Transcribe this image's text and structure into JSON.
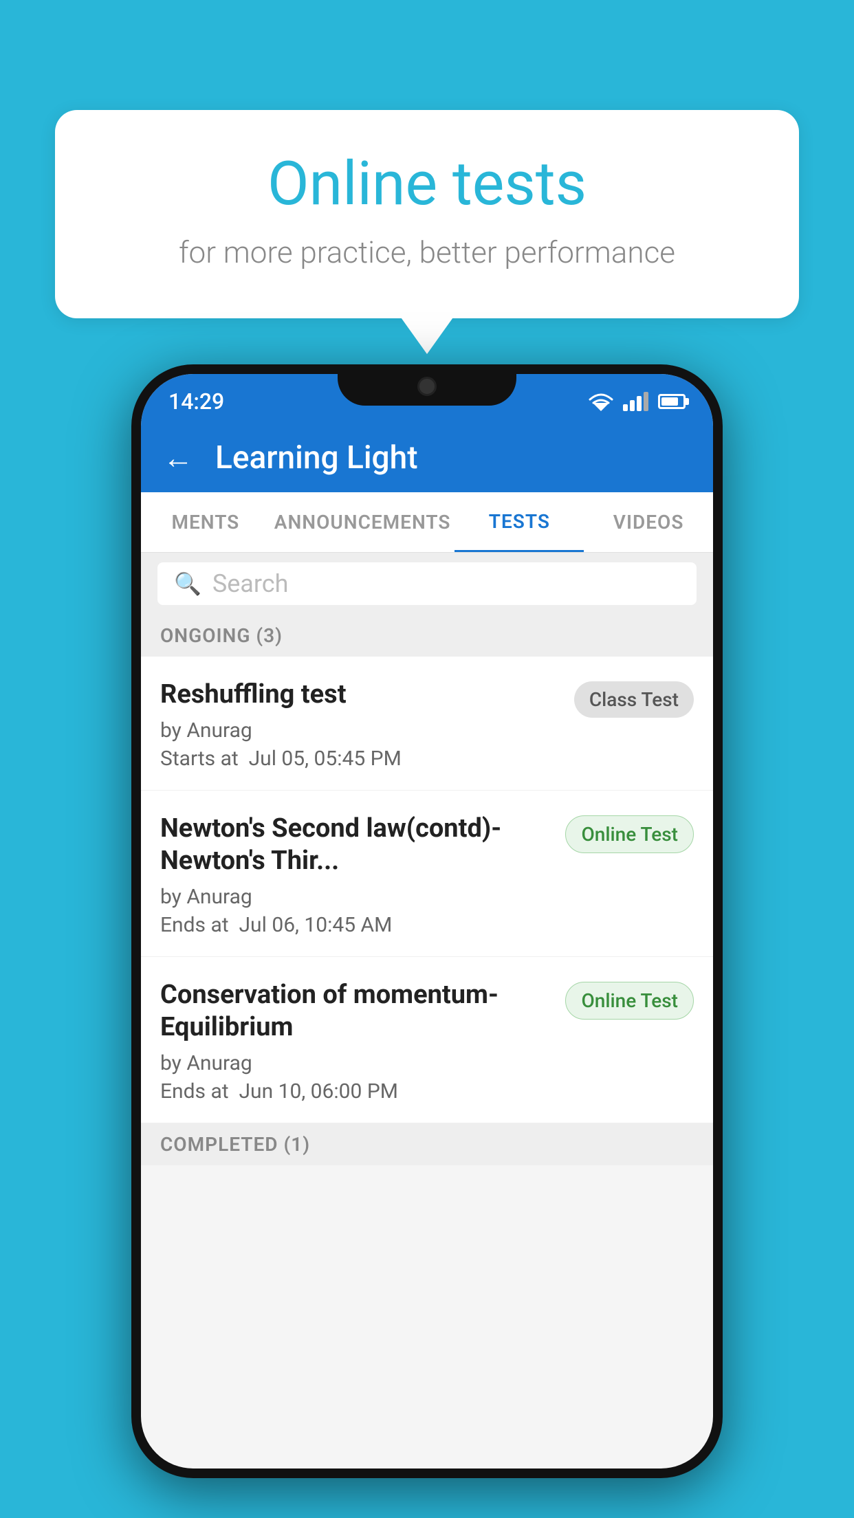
{
  "background_color": "#29b6d8",
  "speech_bubble": {
    "title": "Online tests",
    "subtitle": "for more practice, better performance"
  },
  "phone": {
    "status_bar": {
      "time": "14:29"
    },
    "header": {
      "title": "Learning Light",
      "back_label": "←"
    },
    "tabs": [
      {
        "label": "MENTS",
        "active": false
      },
      {
        "label": "ANNOUNCEMENTS",
        "active": false
      },
      {
        "label": "TESTS",
        "active": true
      },
      {
        "label": "VIDEOS",
        "active": false
      }
    ],
    "search": {
      "placeholder": "Search"
    },
    "ongoing_section": {
      "label": "ONGOING (3)"
    },
    "test_items": [
      {
        "name": "Reshuffling test",
        "by": "by Anurag",
        "time_label": "Starts at",
        "time": "Jul 05, 05:45 PM",
        "badge": "Class Test",
        "badge_type": "class"
      },
      {
        "name": "Newton's Second law(contd)-Newton's Thir...",
        "by": "by Anurag",
        "time_label": "Ends at",
        "time": "Jul 06, 10:45 AM",
        "badge": "Online Test",
        "badge_type": "online"
      },
      {
        "name": "Conservation of momentum-Equilibrium",
        "by": "by Anurag",
        "time_label": "Ends at",
        "time": "Jun 10, 06:00 PM",
        "badge": "Online Test",
        "badge_type": "online"
      }
    ],
    "completed_section": {
      "label": "COMPLETED (1)"
    }
  }
}
